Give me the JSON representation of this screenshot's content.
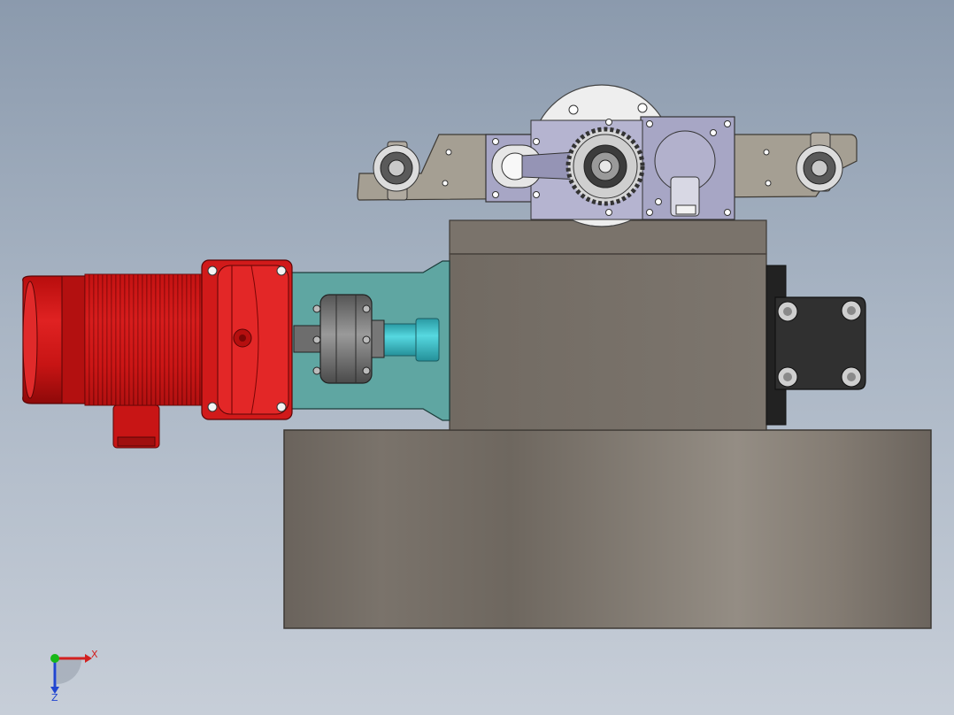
{
  "viewport": {
    "background_top": "#8b9aad",
    "background_bottom": "#c7ced8"
  },
  "colors": {
    "motor_red": "#d41818",
    "motor_dark": "#8f0c0c",
    "housing_teal": "#5fa8a4",
    "shaft_cyan": "#3fc6cf",
    "block_gray": "#787068",
    "base_gray": "#7a726b",
    "plate_gray": "#a7a196",
    "bearing_blue": "#5860b8",
    "gearbox_lilac": "#a9a8c6",
    "bracket_dark": "#2b2b2b"
  },
  "triad": {
    "x_label": "X",
    "z_label": "Z",
    "x_color": "#d22020",
    "y_color": "#18b818",
    "z_color": "#2045d0"
  },
  "parts": {
    "motor": "electric-motor",
    "coupling": "shaft-coupling",
    "housing": "coupling-housing",
    "block": "bearing-block",
    "base": "base-frame",
    "gear_plate": "gear-mechanism-plate",
    "end_bracket": "end-bearing-bracket"
  }
}
